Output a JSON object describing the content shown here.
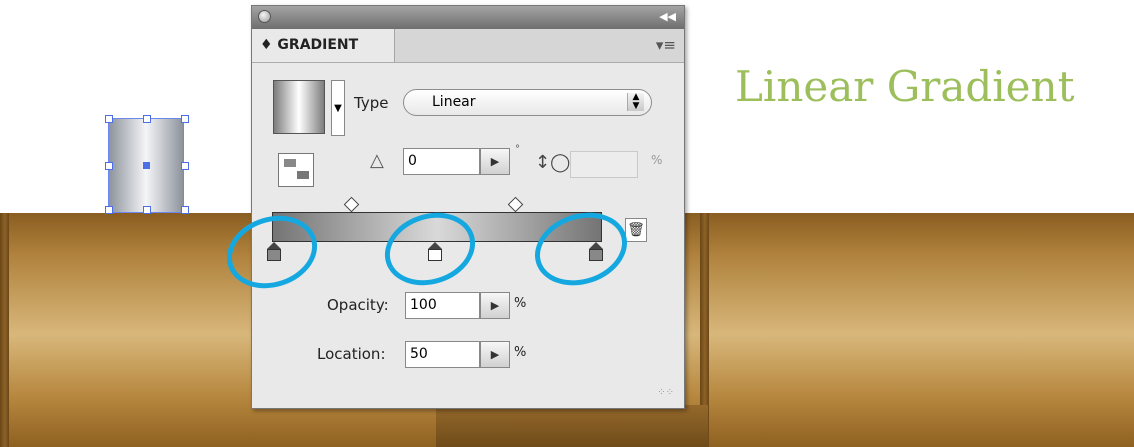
{
  "heading": "Linear Gradient",
  "panel": {
    "tab_title": "♦ GRADIENT",
    "type_label": "Type",
    "type_value": "Linear",
    "angle_value": "0",
    "degree_mark": "°",
    "percent_sign": "%",
    "opacity_label": "Opacity:",
    "opacity_value": "100",
    "location_label": "Location:",
    "location_value": "50",
    "close_icon": "close-icon",
    "collapse_icon": "collapse-icon"
  },
  "colors": {
    "accent": "#9cbf5b",
    "highlight_ring": "#15a8e0",
    "selection": "#4c6fe8"
  }
}
